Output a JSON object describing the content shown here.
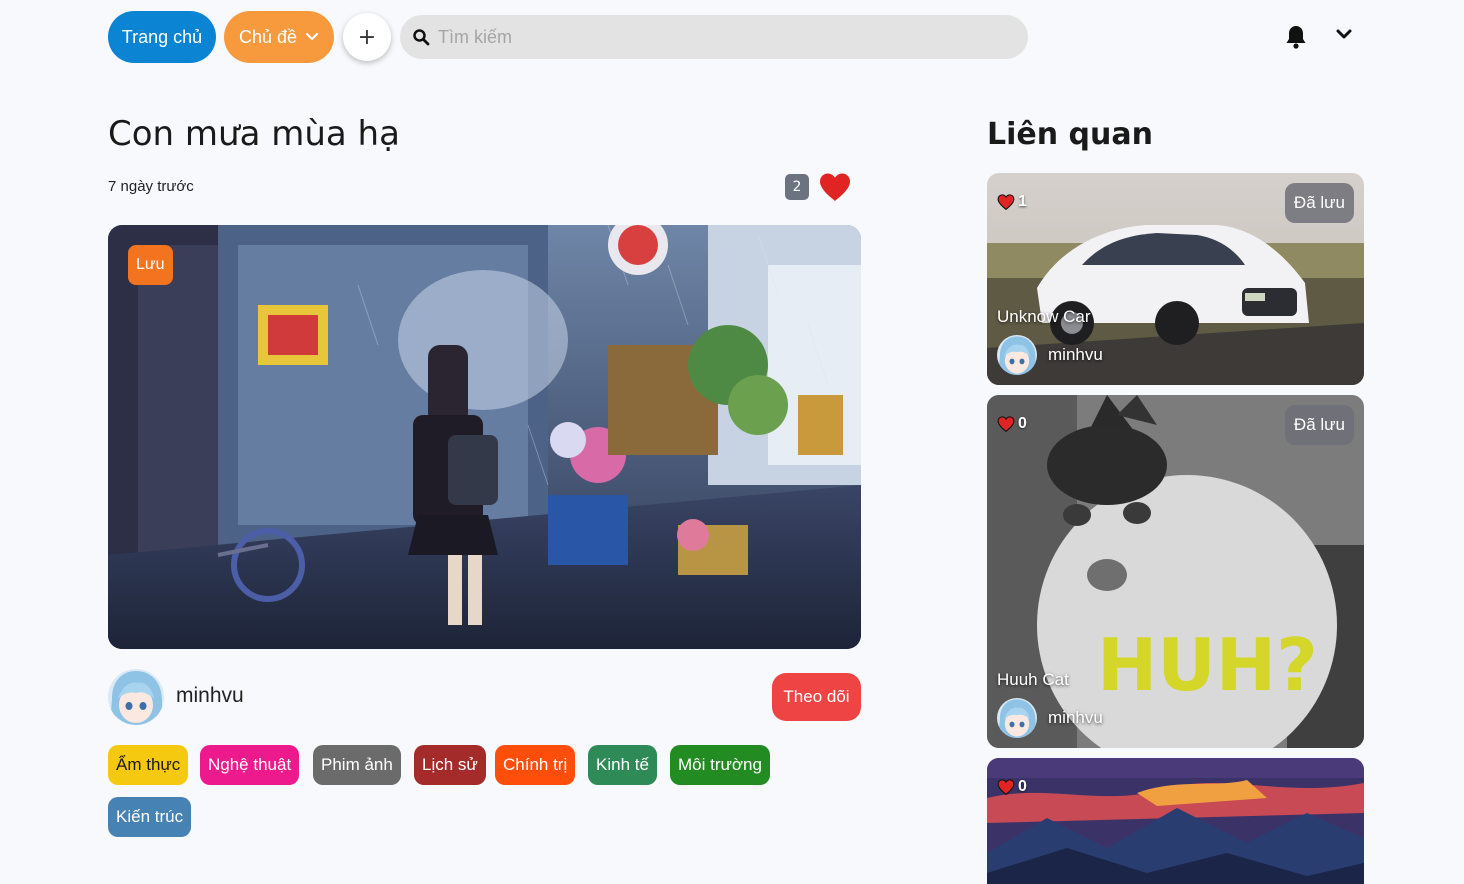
{
  "topbar": {
    "home_label": "Trang chủ",
    "topics_label": "Chủ đề",
    "add_label": "+",
    "search_placeholder": "Tìm kiếm"
  },
  "post": {
    "title": "Con mưa mùa hạ",
    "time_ago": "7 ngày trước",
    "like_count": "2",
    "save_label": "Lưu",
    "author": "minhvu",
    "follow_label": "Theo dõi",
    "tags": [
      {
        "label": "Ẩm thực",
        "bg": "#f5c90f",
        "fg": "#1a1a1a"
      },
      {
        "label": "Nghệ thuật",
        "bg": "#ec1a8c",
        "fg": "#ffffff"
      },
      {
        "label": "Phim ảnh",
        "bg": "#6b6b6b",
        "fg": "#ffffff"
      },
      {
        "label": "Lịch sử",
        "bg": "#a52a2a",
        "fg": "#ffffff"
      },
      {
        "label": "Chính trị",
        "bg": "#ff4d0a",
        "fg": "#ffffff"
      },
      {
        "label": "Kinh tế",
        "bg": "#2e8b57",
        "fg": "#ffffff"
      },
      {
        "label": "Môi trường",
        "bg": "#228b22",
        "fg": "#ffffff"
      },
      {
        "label": "Kiến trúc",
        "bg": "#4682b4",
        "fg": "#ffffff"
      }
    ]
  },
  "sidebar": {
    "title": "Liên quan",
    "cards": [
      {
        "title": "Unknow Car",
        "likes": "1",
        "saved_label": "Đã lưu",
        "author": "minhvu"
      },
      {
        "title": "Huuh Cat",
        "likes": "0",
        "saved_label": "Đã lưu",
        "author": "minhvu"
      },
      {
        "title": "",
        "likes": "0",
        "saved_label": "",
        "author": ""
      }
    ]
  },
  "cat_caption": "HUH?",
  "colors": {
    "primary": "#0b84d4",
    "orange": "#f79a3d",
    "follow": "#ef4444",
    "heart": "#e02424"
  }
}
